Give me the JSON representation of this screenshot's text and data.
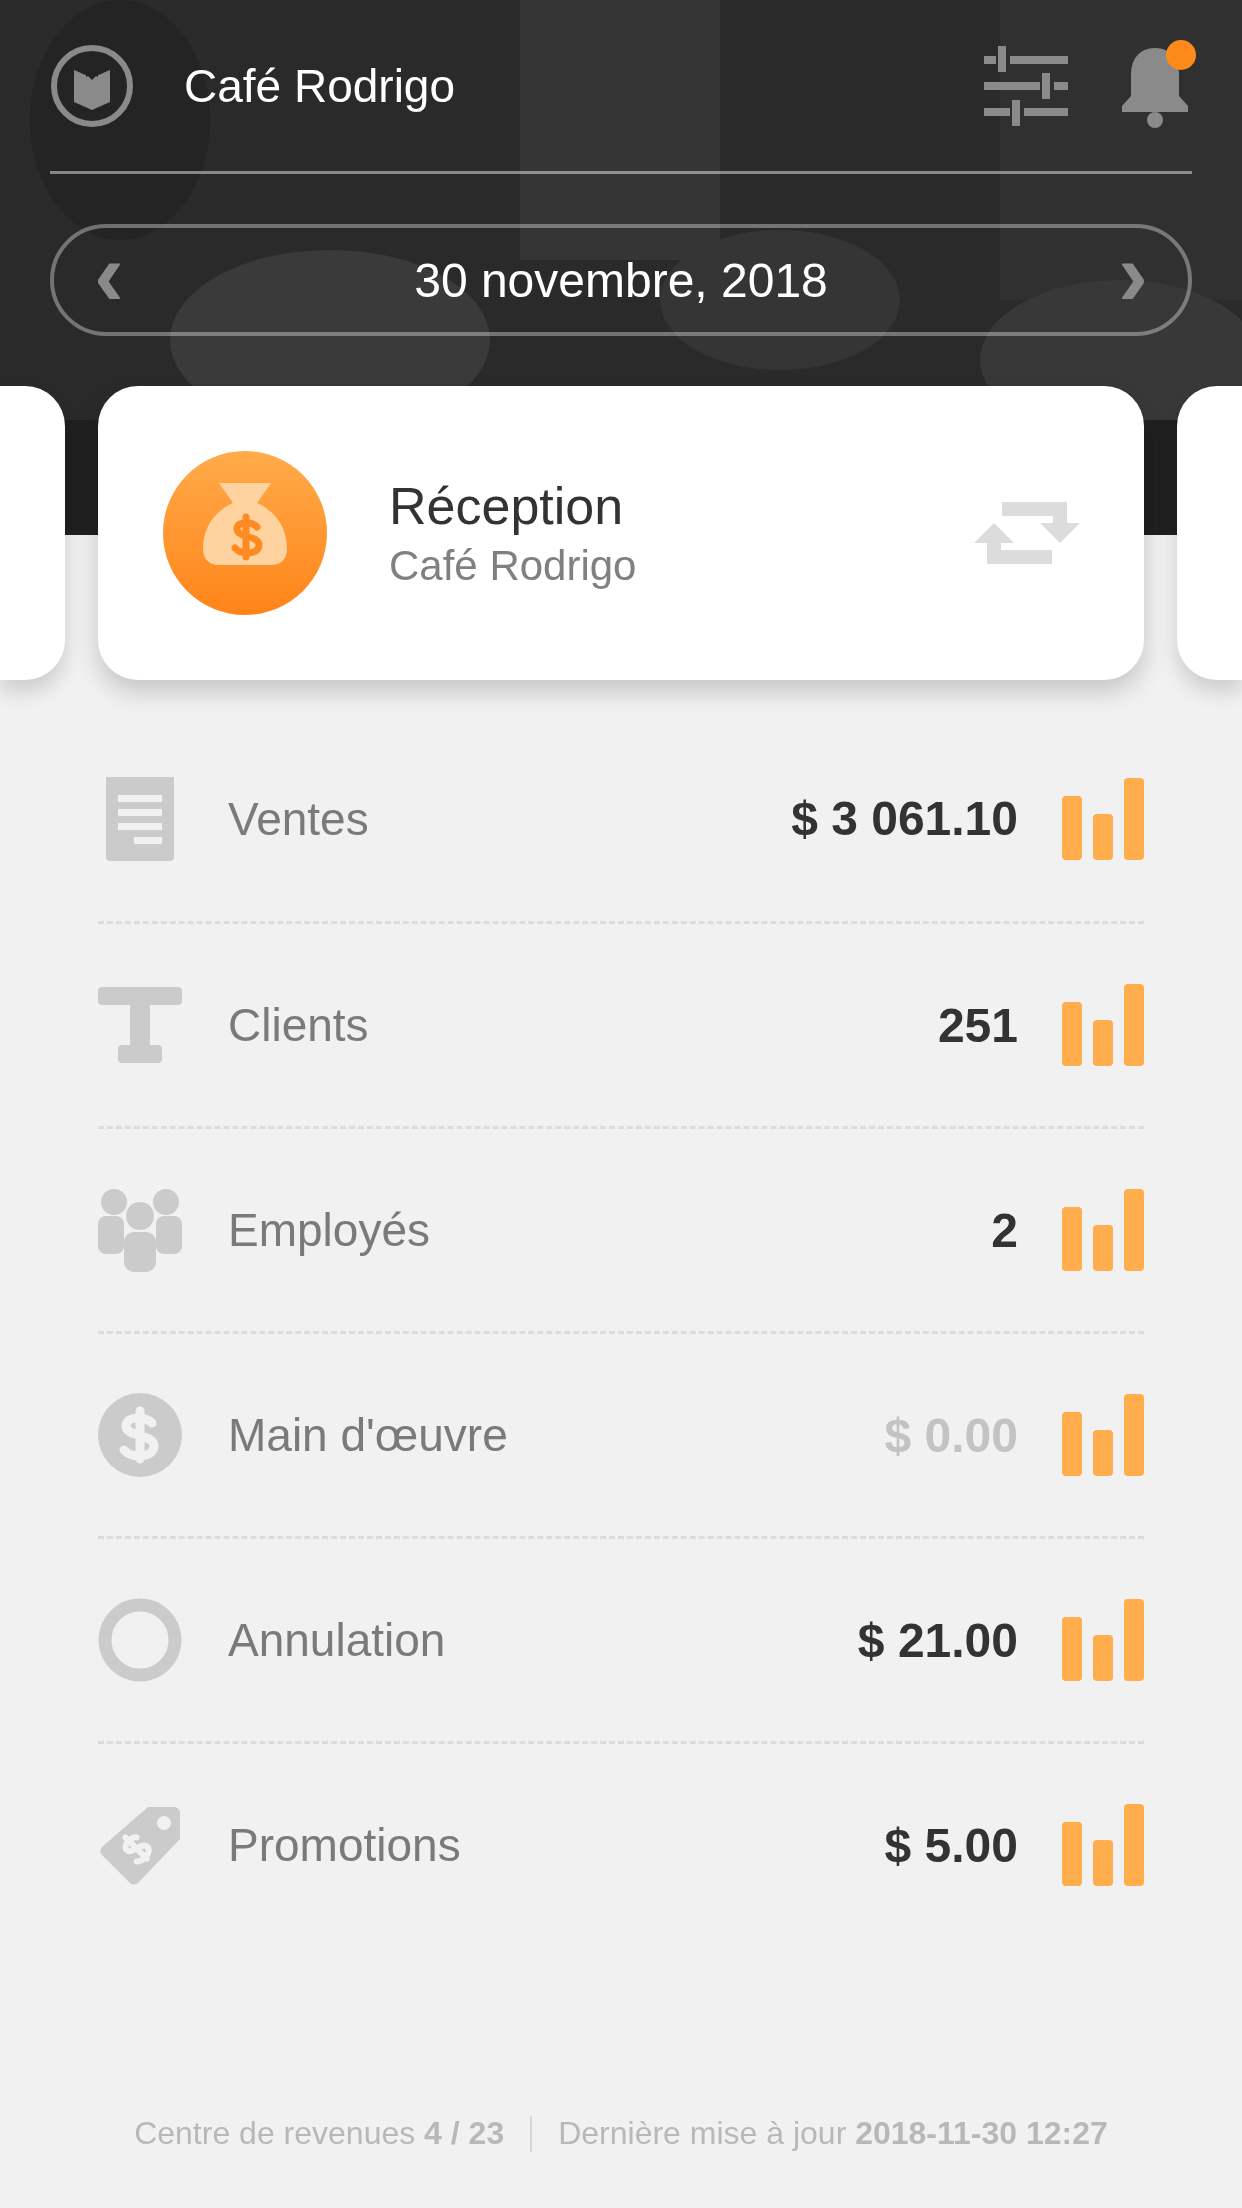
{
  "header": {
    "title": "Café Rodrigo",
    "has_notification": true
  },
  "date_picker": {
    "prev": "‹",
    "date": "30 novembre, 2018",
    "next": "›"
  },
  "card": {
    "title": "Réception",
    "subtitle": "Café Rodrigo"
  },
  "metrics": [
    {
      "kind": "receipt",
      "label": "Ventes",
      "value": "$ 3 061.10",
      "dimmed": false
    },
    {
      "kind": "table",
      "label": "Clients",
      "value": "251",
      "dimmed": false
    },
    {
      "kind": "people",
      "label": "Employés",
      "value": "2",
      "dimmed": false
    },
    {
      "kind": "dollar",
      "label": "Main d'œuvre",
      "value": "$ 0.00",
      "dimmed": true
    },
    {
      "kind": "ring",
      "label": "Annulation",
      "value": "$ 21.00",
      "dimmed": false
    },
    {
      "kind": "tag",
      "label": "Promotions",
      "value": "$ 5.00",
      "dimmed": false
    }
  ],
  "footer": {
    "revenue_center": "Centre de revenues **4 / 23**",
    "last_update": "Dernière mise à jour **2018-11-30 12:27**"
  }
}
